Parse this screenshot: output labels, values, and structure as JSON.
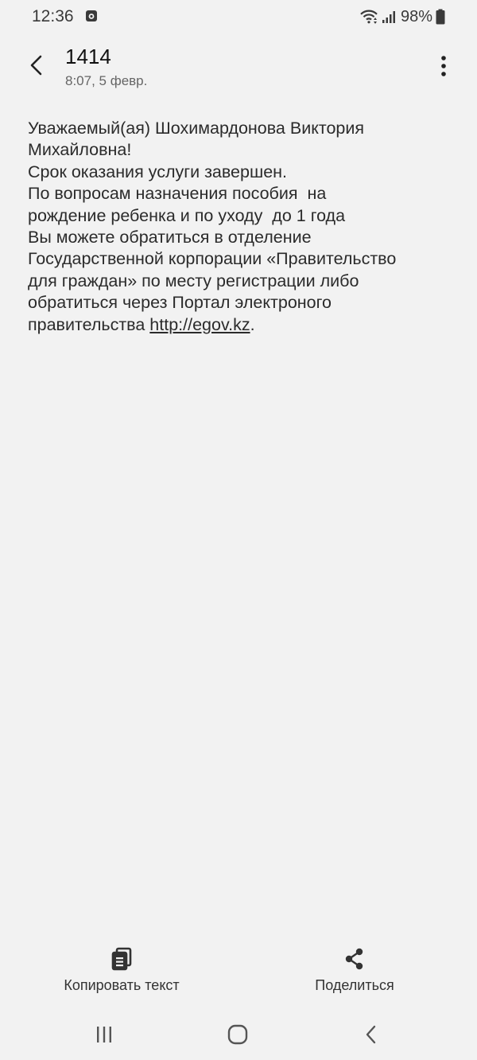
{
  "status_bar": {
    "time": "12:36",
    "battery": "98%"
  },
  "header": {
    "title": "1414",
    "subtitle": "8:07, 5 февр."
  },
  "message": {
    "lines": [
      "Уважаемый(ая) Шохимардонова Виктория",
      "Михайловна!",
      "Срок оказания услуги завершен.",
      "По вопросам назначения пособия  на",
      "рождение ребенка и по уходу  до 1 года",
      "Вы можете обратиться в отделение",
      "Государственной корпорации «Правительство",
      "для граждан» по месту регистрации либо",
      "обратиться через Портал электроного"
    ],
    "last_line_prefix": "правительства ",
    "link_text": "http://egov.kz",
    "last_line_suffix": "."
  },
  "actions": {
    "copy_label": "Копировать текст",
    "share_label": "Поделиться"
  }
}
